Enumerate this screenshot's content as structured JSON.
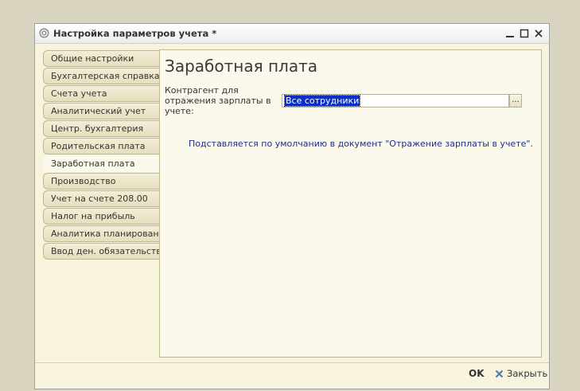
{
  "window": {
    "title": "Настройка параметров учета *"
  },
  "tabs": [
    {
      "label": "Общие настройки"
    },
    {
      "label": "Бухгалтерская справка"
    },
    {
      "label": "Счета учета"
    },
    {
      "label": "Аналитический учет"
    },
    {
      "label": "Центр. бухгалтерия"
    },
    {
      "label": "Родительская плата"
    },
    {
      "label": "Заработная плата",
      "active": true
    },
    {
      "label": "Производство"
    },
    {
      "label": "Учет на счете 208.00"
    },
    {
      "label": "Налог на прибыль"
    },
    {
      "label": "Аналитика планирования"
    },
    {
      "label": "Ввод ден. обязательств"
    }
  ],
  "panel": {
    "title": "Заработная плата",
    "field_label": "Контрагент для отражения зарплаты в учете:",
    "field_value": "Все сотрудники",
    "pick_button": "...",
    "hint": "Подставляется по умолчанию в документ \"Отражение зарплаты в учете\"."
  },
  "footer": {
    "ok_label": "OK",
    "close_label": "Закрыть"
  },
  "colors": {
    "window_bg": "#f7f3dd",
    "panel_bg": "#fbf9ec",
    "hint_text": "#1b2f8c",
    "selection": "#0a2ecb"
  },
  "icons": {
    "app": "gear-icon",
    "minimize": "minimize-icon",
    "maximize": "maximize-icon",
    "close": "close-icon",
    "footer_close": "x-icon"
  }
}
